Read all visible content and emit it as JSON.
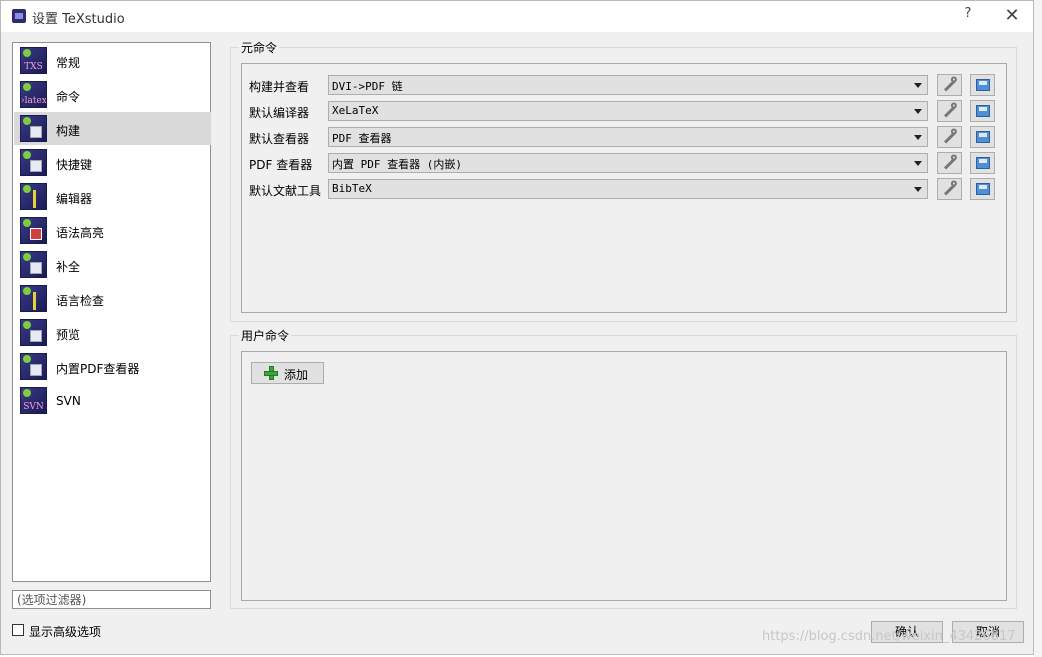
{
  "window": {
    "title": "设置 TeXstudio",
    "help_label": "?",
    "close_label": "✕"
  },
  "sidebar": {
    "items": [
      {
        "label": "常规",
        "icon": "txs-icon",
        "glyph": "TXS"
      },
      {
        "label": "命令",
        "icon": "latex-icon",
        "glyph": "›latex"
      },
      {
        "label": "构建",
        "icon": "build-icon",
        "glyph": ""
      },
      {
        "label": "快捷键",
        "icon": "keyboard-icon",
        "glyph": ""
      },
      {
        "label": "编辑器",
        "icon": "editor-icon",
        "glyph": ""
      },
      {
        "label": "语法高亮",
        "icon": "syntax-highlight-icon",
        "glyph": ""
      },
      {
        "label": "补全",
        "icon": "completion-icon",
        "glyph": ""
      },
      {
        "label": "语言检查",
        "icon": "language-check-icon",
        "glyph": ""
      },
      {
        "label": "预览",
        "icon": "preview-icon",
        "glyph": ""
      },
      {
        "label": "内置PDF查看器",
        "icon": "pdf-viewer-icon",
        "glyph": ""
      },
      {
        "label": "SVN",
        "icon": "svn-icon",
        "glyph": "SVN"
      }
    ],
    "selected_index": 2,
    "filter_placeholder": "(选项过滤器)"
  },
  "advanced": {
    "label": "显示高级选项",
    "checked": false
  },
  "meta_commands": {
    "title": "元命令",
    "rows": [
      {
        "label": "构建并查看",
        "value": "DVI->PDF 链"
      },
      {
        "label": "默认编译器",
        "value": "XeLaTeX"
      },
      {
        "label": "默认查看器",
        "value": "PDF 查看器"
      },
      {
        "label": "PDF 查看器",
        "value": "内置 PDF 查看器 (内嵌)"
      },
      {
        "label": "默认文献工具",
        "value": "BibTeX"
      }
    ]
  },
  "user_commands": {
    "title": "用户命令",
    "add_label": "添加"
  },
  "buttons": {
    "ok_label": "确认",
    "cancel_label": "取消"
  },
  "watermark": "https://blog.csdn.net/weixin_43426817",
  "colors": {
    "window_bg": "#f0f0f0",
    "selected_bg": "#d9d9d9",
    "icon_bg": "#2b2b6e",
    "plus_green": "#3aa53a",
    "disk_blue": "#4f8fd6"
  }
}
